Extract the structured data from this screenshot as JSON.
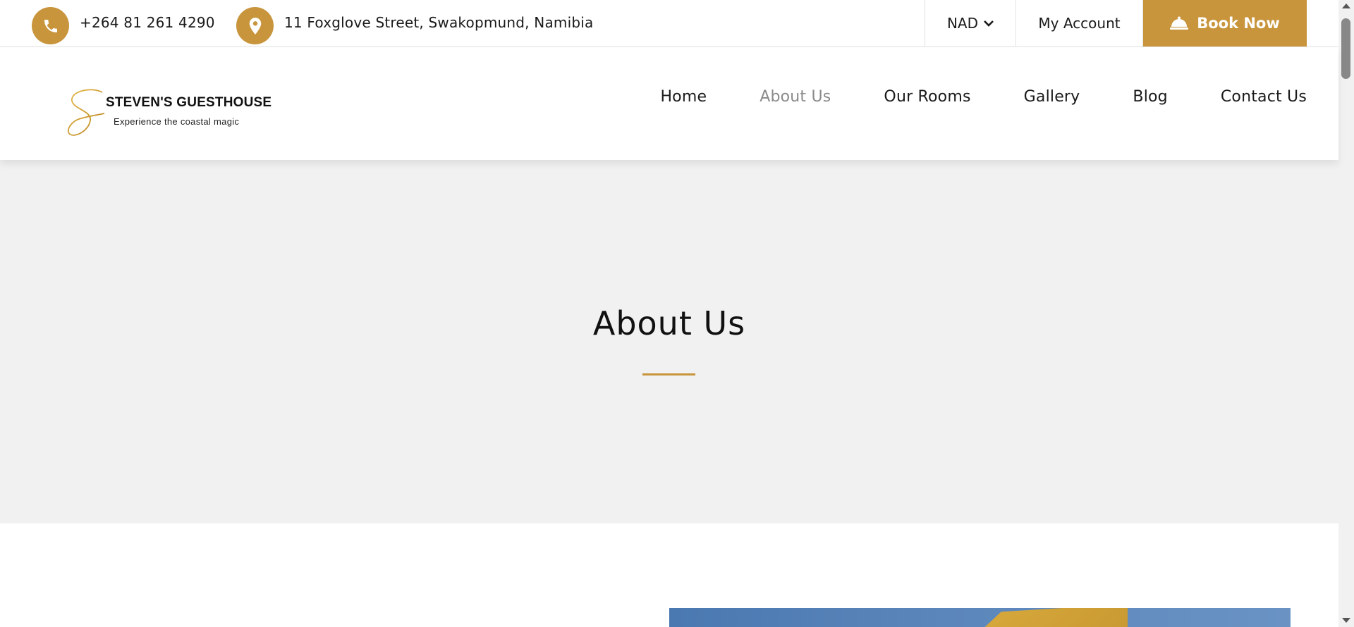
{
  "topbar": {
    "phone": "+264 81 261 4290",
    "address": "11 Foxglove Street, Swakopmund, Namibia",
    "currency": "NAD",
    "account_label": "My Account",
    "book_label": "Book Now"
  },
  "brand": {
    "name": "STEVEN'S GUESTHOUSE",
    "tagline": "Experience the coastal magic"
  },
  "nav": {
    "items": [
      {
        "label": "Home",
        "active": false
      },
      {
        "label": "About Us",
        "active": true
      },
      {
        "label": "Our Rooms",
        "active": false
      },
      {
        "label": "Gallery",
        "active": false
      },
      {
        "label": "Blog",
        "active": false
      },
      {
        "label": "Contact Us",
        "active": false
      }
    ]
  },
  "hero": {
    "title": "About Us"
  },
  "colors": {
    "accent": "#c8953c",
    "hero_bg": "#f1f1f1",
    "nav_active": "#8a8a8a"
  },
  "icons": {
    "phone": "phone-icon",
    "location": "map-pin-icon",
    "chevron": "chevron-down-icon",
    "bell": "service-bell-icon"
  }
}
